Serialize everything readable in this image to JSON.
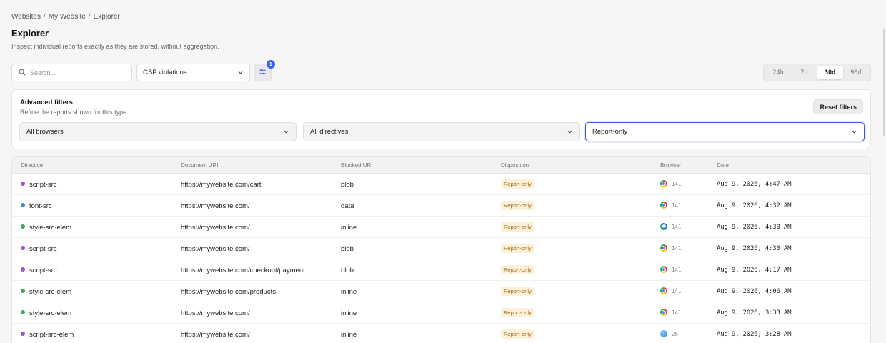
{
  "breadcrumb": [
    "Websites",
    "My Website",
    "Explorer"
  ],
  "page": {
    "title": "Explorer",
    "subtitle": "Inspect individual reports exactly as they are stored, without aggregation."
  },
  "search": {
    "placeholder": "Search..."
  },
  "report_type": {
    "selected": "CSP violations"
  },
  "filter_button": {
    "badge": "1",
    "icon": "sliders-icon"
  },
  "time_range": {
    "options": [
      "24h",
      "7d",
      "30d",
      "90d"
    ],
    "selected": "30d"
  },
  "advanced_filters": {
    "title": "Advanced filters",
    "subtitle": "Refine the reports shown for this type.",
    "reset_label": "Reset filters",
    "browser_select": "All browsers",
    "directive_select": "All directives",
    "disposition_select": "Report-only"
  },
  "table": {
    "columns": [
      "Directive",
      "Document URI",
      "Blocked URI",
      "Disposition",
      "Browser",
      "Date"
    ],
    "rows": [
      {
        "directive": "script-src",
        "dot": "#9b4de0",
        "document_uri": "https://mywebsite.com/cart",
        "blocked_uri": "blob",
        "disposition": "Report-only",
        "browser": "chrome",
        "version": "141",
        "date": "Aug 9, 2026, 4:47 AM"
      },
      {
        "directive": "font-src",
        "dot": "#3b8fc9",
        "document_uri": "https://mywebsite.com/",
        "blocked_uri": "data",
        "disposition": "Report-only",
        "browser": "chrome",
        "version": "141",
        "date": "Aug 9, 2026, 4:32 AM"
      },
      {
        "directive": "style-src-elem",
        "dot": "#3fa85a",
        "document_uri": "https://mywebsite.com/",
        "blocked_uri": "inline",
        "disposition": "Report-only",
        "browser": "edge",
        "version": "141",
        "date": "Aug 9, 2026, 4:30 AM"
      },
      {
        "directive": "script-src",
        "dot": "#9b4de0",
        "document_uri": "https://mywebsite.com/",
        "blocked_uri": "blob",
        "disposition": "Report-only",
        "browser": "chrome",
        "version": "141",
        "date": "Aug 9, 2026, 4:30 AM"
      },
      {
        "directive": "script-src",
        "dot": "#9b4de0",
        "document_uri": "https://mywebsite.com/checkout/payment",
        "blocked_uri": "blob",
        "disposition": "Report-only",
        "browser": "chrome",
        "version": "141",
        "date": "Aug 9, 2026, 4:17 AM"
      },
      {
        "directive": "style-src-elem",
        "dot": "#3fa85a",
        "document_uri": "https://mywebsite.com/products",
        "blocked_uri": "inline",
        "disposition": "Report-only",
        "browser": "chrome",
        "version": "141",
        "date": "Aug 9, 2026, 4:06 AM"
      },
      {
        "directive": "style-src-elem",
        "dot": "#3fa85a",
        "document_uri": "https://mywebsite.com/",
        "blocked_uri": "inline",
        "disposition": "Report-only",
        "browser": "chrome",
        "version": "141",
        "date": "Aug 9, 2026, 3:33 AM"
      },
      {
        "directive": "script-src-elem",
        "dot": "#9b4de0",
        "document_uri": "https://mywebsite.com/",
        "blocked_uri": "inline",
        "disposition": "Report-only",
        "browser": "safari",
        "version": "26",
        "date": "Aug 9, 2026, 3:28 AM"
      }
    ]
  },
  "colors": {
    "accent": "#3b5bd9",
    "badge": "#3563e9",
    "pill_bg": "#fdf0d8",
    "pill_text": "#9a6410"
  }
}
